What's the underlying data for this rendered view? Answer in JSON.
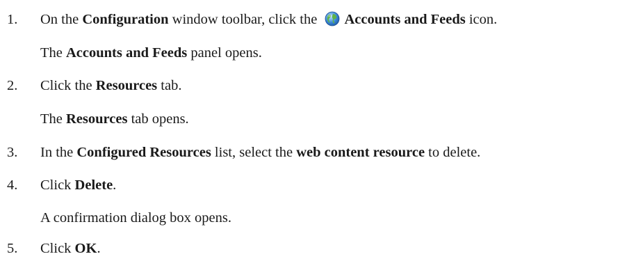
{
  "steps": [
    {
      "number": "1.",
      "parts": {
        "a": "On the ",
        "b": "Configuration",
        "c": " window toolbar, click the ",
        "d": "Accounts and Feeds",
        "e": " icon."
      },
      "icon": "globe-icon",
      "result": {
        "a": "The ",
        "b": "Accounts and Feeds",
        "c": " panel opens."
      }
    },
    {
      "number": "2.",
      "parts": {
        "a": "Click the ",
        "b": "Resources",
        "c": " tab."
      },
      "result": {
        "a": "The ",
        "b": "Resources",
        "c": " tab opens."
      }
    },
    {
      "number": "3.",
      "parts": {
        "a": "In the ",
        "b": "Configured Resources",
        "c": " list, select the ",
        "d": "web content resource",
        "e": " to delete."
      }
    },
    {
      "number": "4.",
      "parts": {
        "a": "Click ",
        "b": "Delete",
        "c": "."
      },
      "result": {
        "a": "A confirmation dialog box opens."
      }
    },
    {
      "number": "5.",
      "parts": {
        "a": "Click ",
        "b": "OK",
        "c": "."
      }
    }
  ],
  "colors": {
    "text": "#1a1a1a",
    "icon_globe_blue": "#3a86d6",
    "icon_globe_green": "#5fb34a"
  }
}
